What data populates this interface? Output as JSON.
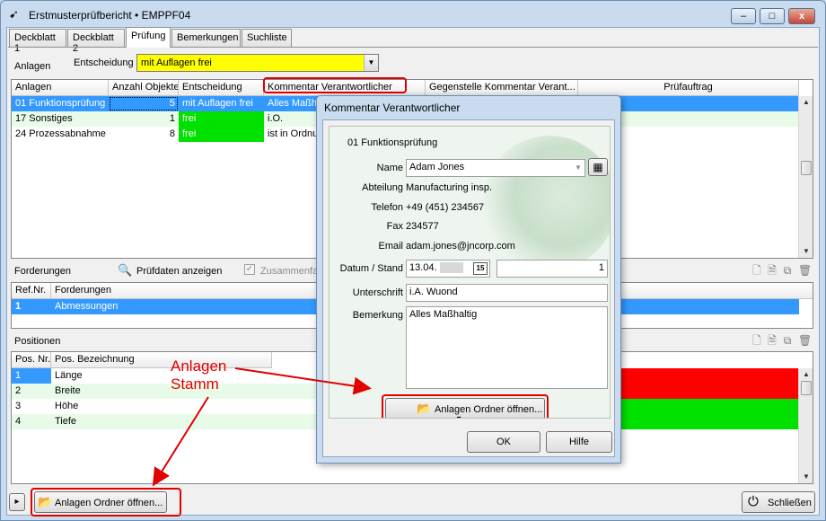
{
  "window": {
    "title": "Erstmusterprüfbericht • EMPPF04",
    "minimize": "–",
    "maximize": "□",
    "close": "x"
  },
  "tabs": [
    {
      "label": "Deckblatt 1"
    },
    {
      "label": "Deckblatt 2"
    },
    {
      "label": "Prüfung"
    },
    {
      "label": "Bemerkungen"
    },
    {
      "label": "Suchliste"
    }
  ],
  "anlagen_section": {
    "title": "Anlagen",
    "entscheidung_label": "Entscheidung",
    "entscheidung_value": "mit Auflagen frei"
  },
  "anlagen_grid": {
    "columns": [
      "Anlagen",
      "Anzahl Objekte",
      "Entscheidung",
      "Kommentar Verantwortlicher",
      "Gegenstelle Kommentar Verant...",
      "Prüfauftrag"
    ],
    "rows": [
      {
        "anlage": "01 Funktionsprüfung",
        "anzahl": "5",
        "entscheidung": "mit Auflagen frei",
        "kommentar": "Alles Maßh"
      },
      {
        "anlage": "17 Sonstiges",
        "anzahl": "1",
        "entscheidung": "frei",
        "kommentar": "i.O."
      },
      {
        "anlage": "24 Prozessabnahme",
        "anzahl": "8",
        "entscheidung": "frei",
        "kommentar": "ist in Ordnu"
      }
    ]
  },
  "forderungen_section": {
    "title": "Forderungen",
    "pruefdaten_label": "Prüfdaten anzeigen",
    "zusammenfassen_label": "Zusammenfa"
  },
  "forderungen_grid": {
    "columns": [
      "Ref.Nr.",
      "Forderungen"
    ],
    "rows": [
      {
        "ref": "1",
        "forderung": "Abmessungen"
      }
    ]
  },
  "positionen_section": {
    "title": "Positionen"
  },
  "positionen_grid": {
    "columns": [
      "Pos. Nr.",
      "Pos. Bezeichnung"
    ],
    "rows": [
      {
        "nr": "1",
        "bez": "Länge"
      },
      {
        "nr": "2",
        "bez": "Breite"
      },
      {
        "nr": "3",
        "bez": "Höhe"
      },
      {
        "nr": "4",
        "bez": "Tiefe"
      }
    ]
  },
  "annotation": {
    "line1": "Anlagen",
    "line2": "Stamm"
  },
  "footer": {
    "expand_icon": "▸",
    "open_folder_label": "Anlagen Ordner öffnen...",
    "close_label": "Schließen"
  },
  "dialog": {
    "title": "Kommentar Verantwortlicher",
    "header": "01 Funktionsprüfung",
    "name_label": "Name",
    "name_value": "Adam Jones",
    "abteilung_label": "Abteilung",
    "abteilung_value": "Manufacturing insp.",
    "telefon_label": "Telefon",
    "telefon_value": "+49 (451) 234567",
    "fax_label": "Fax",
    "fax_value": "234577",
    "email_label": "Email",
    "email_value": "adam.jones@jncorp.com",
    "datum_label": "Datum / Stand",
    "datum_value": "13.04.",
    "calendar_icon_text": "15",
    "stand_value": "1",
    "unterschrift_label": "Unterschrift",
    "unterschrift_value": "i.A. Wuond",
    "bemerkung_label": "Bemerkung",
    "bemerkung_value": "Alles Maßhaltig",
    "open_folder_label": "Anlagen Ordner öffnen...",
    "ok_label": "OK",
    "hilfe_label": "Hilfe"
  },
  "colors": {
    "selection": "#3399ff",
    "decision_frei": "#00e100",
    "decision_yellow": "#ffff00",
    "status_red": "#ff0000",
    "annotation_red": "#e10000"
  }
}
